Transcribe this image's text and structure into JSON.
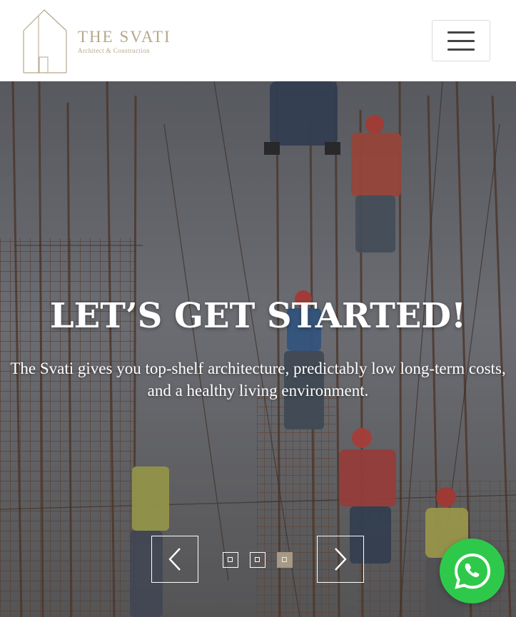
{
  "header": {
    "brand_name": "THE SVATI",
    "brand_tagline": "Architect & Construction",
    "menu_icon": "hamburger-menu-icon"
  },
  "hero": {
    "title": "LET’S GET STARTED!",
    "subtitle": "The Svati gives you top-shelf architecture, predictably low long-term costs, and a healthy living environment.",
    "background": "construction workers on rebar scaffolding",
    "slider": {
      "prev_icon": "chevron-left-icon",
      "next_icon": "chevron-right-icon",
      "dot_count": 3,
      "active_dot": 3
    }
  },
  "floating": {
    "whatsapp_icon": "whatsapp-icon"
  },
  "colors": {
    "brand": "#b6a78b",
    "active_dot": "#a69985",
    "whatsapp": "#2ec94a"
  }
}
